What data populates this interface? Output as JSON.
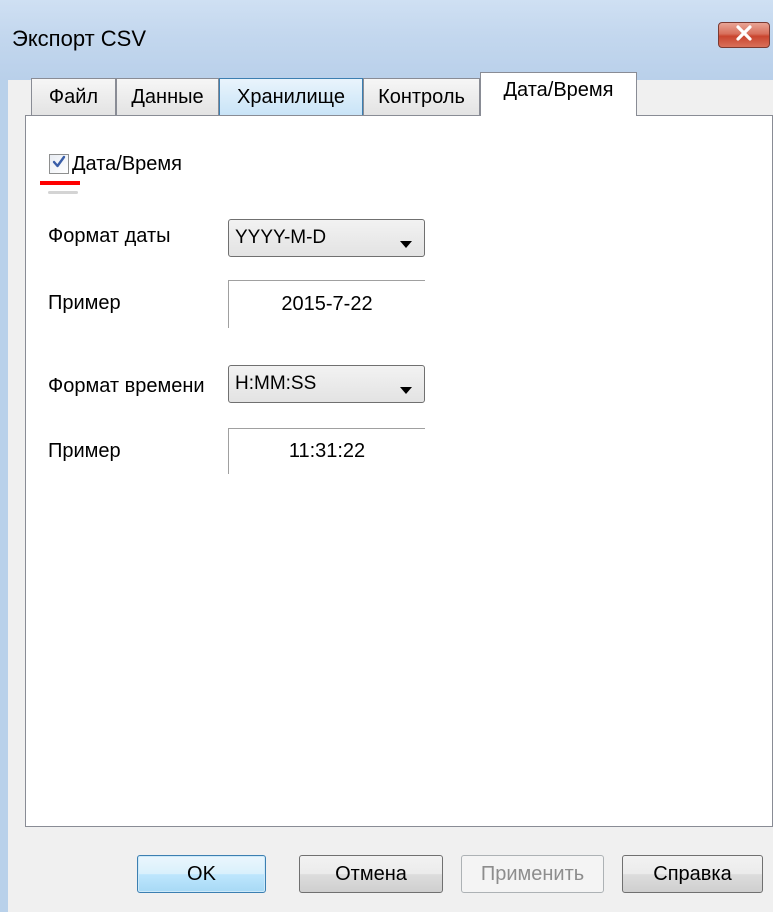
{
  "window": {
    "title": "Экспорт CSV",
    "close_icon": "close-x-icon"
  },
  "tabs": [
    {
      "label": "Файл",
      "state": "normal"
    },
    {
      "label": "Данные",
      "state": "normal"
    },
    {
      "label": "Хранилище",
      "state": "hover"
    },
    {
      "label": "Контроль",
      "state": "normal"
    },
    {
      "label": "Дата/Время",
      "state": "active"
    }
  ],
  "datetime": {
    "enabled_label": "Дата/Время",
    "enabled": true,
    "date_format_label": "Формат даты",
    "date_format_value": "YYYY-M-D",
    "date_example_label": "Пример",
    "date_example_value": "2015-7-22",
    "time_format_label": "Формат времени",
    "time_format_value": "H:MM:SS",
    "time_example_label": "Пример",
    "time_example_value": "11:31:22"
  },
  "buttons": {
    "ok": "OK",
    "cancel": "Отмена",
    "apply": "Применить",
    "help": "Справка"
  },
  "colors": {
    "highlight_underline": "#ff0000",
    "hover_tab": "#c9e4f7"
  }
}
